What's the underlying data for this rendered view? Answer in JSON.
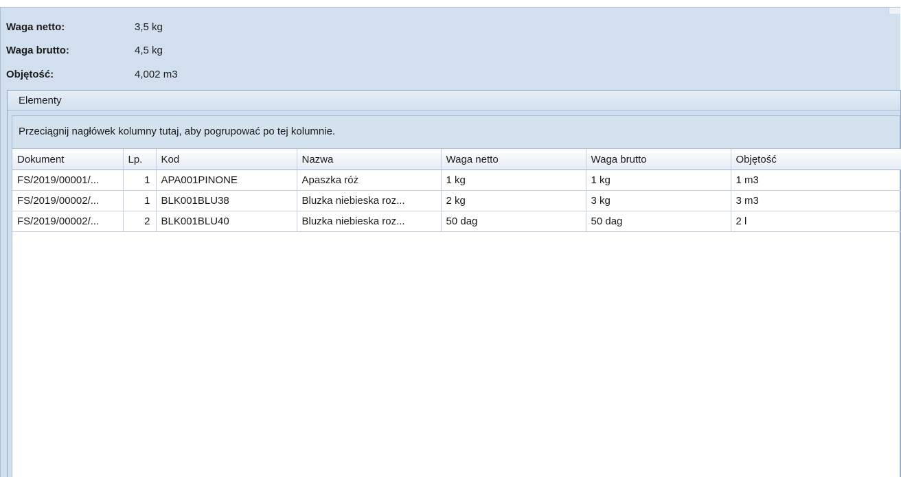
{
  "summary": {
    "net_weight_label": "Waga netto:",
    "net_weight_value": "3,5 kg",
    "gross_weight_label": "Waga brutto:",
    "gross_weight_value": "4,5 kg",
    "volume_label": "Objętość:",
    "volume_value": "4,002 m3"
  },
  "elements": {
    "title": "Elementy",
    "group_hint": "Przeciągnij nagłówek kolumny tutaj, aby pogrupować po tej kolumnie.",
    "columns": [
      "Dokument",
      "Lp.",
      "Kod",
      "Nazwa",
      "Waga netto",
      "Waga brutto",
      "Objętość"
    ],
    "rows": [
      [
        "FS/2019/00001/...",
        "1",
        "APA001PINONE",
        "Apaszka róż",
        "1 kg",
        "1 kg",
        "1 m3"
      ],
      [
        "FS/2019/00002/...",
        "1",
        "BLK001BLU38",
        "Bluzka niebieska roz...",
        "2 kg",
        "3 kg",
        "3 m3"
      ],
      [
        "FS/2019/00002/...",
        "2",
        "BLK001BLU40",
        "Bluzka niebieska roz...",
        "50 dag",
        "50 dag",
        "2 l"
      ]
    ]
  }
}
